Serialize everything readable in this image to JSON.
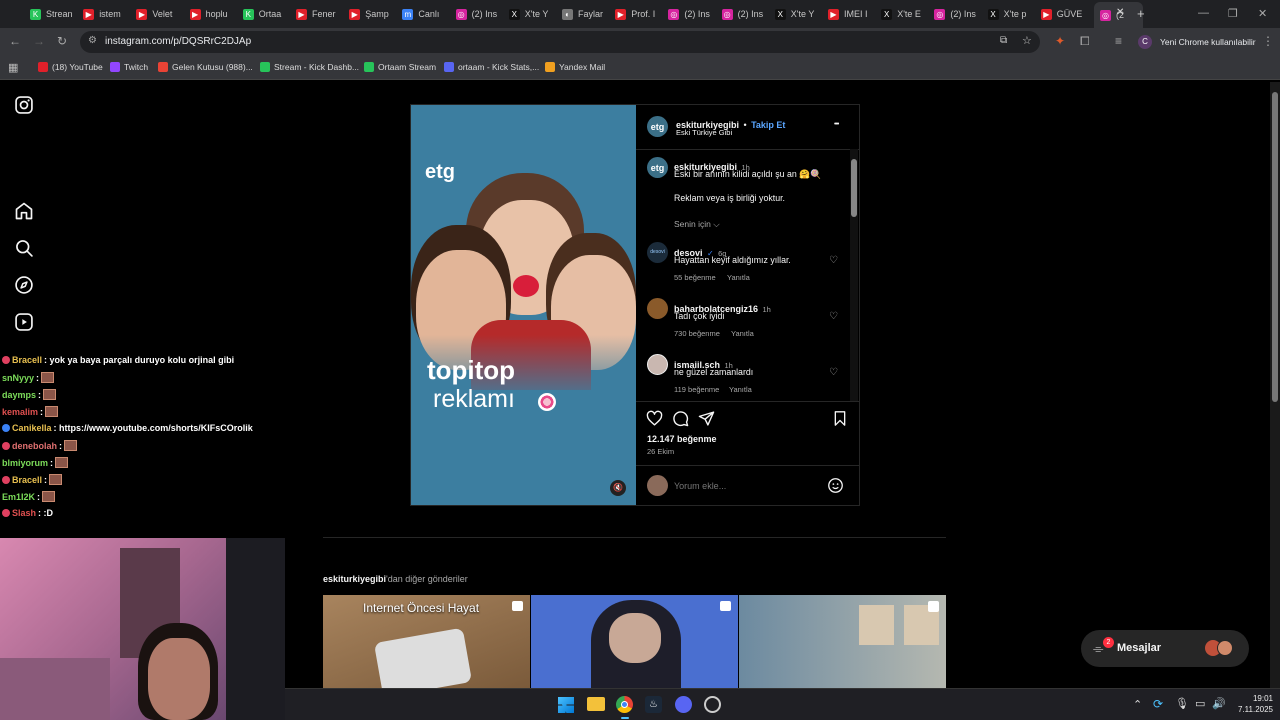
{
  "browser": {
    "tabs": [
      {
        "label": "Strean",
        "color": "#27c45a",
        "glyph": "K"
      },
      {
        "label": "istem",
        "color": "#e0202a",
        "glyph": "▶"
      },
      {
        "label": "Velet",
        "color": "#e0202a",
        "glyph": "▶"
      },
      {
        "label": "hoplu",
        "color": "#e0202a",
        "glyph": "▶"
      },
      {
        "label": "Ortaa",
        "color": "#27c45a",
        "glyph": "K"
      },
      {
        "label": "Fener",
        "color": "#e0202a",
        "glyph": "▶"
      },
      {
        "label": "Şamp",
        "color": "#e0202a",
        "glyph": "▶"
      },
      {
        "label": "Canlı",
        "color": "#3b82f6",
        "glyph": "m"
      },
      {
        "label": "(2) Ins",
        "color": "#d6249f",
        "glyph": "◎"
      },
      {
        "label": "X'te Y",
        "color": "#111111",
        "glyph": "X"
      },
      {
        "label": "Faylar",
        "color": "#777777",
        "glyph": "◐"
      },
      {
        "label": "Prof. I",
        "color": "#e0202a",
        "glyph": "▶"
      },
      {
        "label": "(2) Ins",
        "color": "#d6249f",
        "glyph": "◎"
      },
      {
        "label": "(2) Ins",
        "color": "#d6249f",
        "glyph": "◎"
      },
      {
        "label": "X'te Y",
        "color": "#111111",
        "glyph": "X"
      },
      {
        "label": "IMEI I",
        "color": "#e0202a",
        "glyph": "▶"
      },
      {
        "label": "X'te E",
        "color": "#111111",
        "glyph": "X"
      },
      {
        "label": "(2) Ins",
        "color": "#d6249f",
        "glyph": "◎"
      },
      {
        "label": "X'te p",
        "color": "#111111",
        "glyph": "X"
      },
      {
        "label": "GÜVE",
        "color": "#e0202a",
        "glyph": "▶"
      },
      {
        "label": "(2",
        "color": "#d6249f",
        "glyph": "◎"
      }
    ],
    "new_tab": "+",
    "url": "instagram.com/p/DQSRrC2DJAp",
    "update_label": "Yeni Chrome kullanılabilir",
    "profile_initial": "C",
    "bookmarks": [
      {
        "label": "(18) YouTube",
        "color": "#e0202a"
      },
      {
        "label": "Twitch",
        "color": "#9146ff"
      },
      {
        "label": "Gelen Kutusu (988)...",
        "color": "#ea4335"
      },
      {
        "label": "Stream - Kick Dashb...",
        "color": "#27c45a"
      },
      {
        "label": "Ortaam Stream",
        "color": "#27c45a"
      },
      {
        "label": "ortaam - Kick Stats,...",
        "color": "#5865f2"
      },
      {
        "label": "Yandex Mail",
        "color": "#f0a020"
      }
    ]
  },
  "post": {
    "media_logo": "etg",
    "media_title_1": "topitop",
    "media_title_2": "reklamı",
    "author": "eskiturkiyegibi",
    "dot": "•",
    "follow": "Takip Et",
    "author_subtitle": "Eski Türkiye Gibi",
    "more": "•••",
    "caption_author": "eskiturkiyegibi",
    "caption_time": "1h",
    "caption_text": "Eski bir anının kilidi açıldı şu an 🤗🍭",
    "caption_text2": "Reklam veya iş birliği yoktur.",
    "for_you": "Senin için ⌵",
    "comments": [
      {
        "user": "desovi",
        "verified": "✓",
        "time": "6g",
        "text": "Hayattan keyif aldığımız yıllar.",
        "likes": "55 beğenme",
        "reply": "Yanıtla",
        "color": "#1b2b3a"
      },
      {
        "user": "baharbolatcengiz16",
        "verified": "",
        "time": "1h",
        "text": "Tadı çok iyidi",
        "likes": "730 beğenme",
        "reply": "Yanıtla",
        "color": "#8a5a2a"
      },
      {
        "user": "ismaiil.sch",
        "verified": "",
        "time": "1h",
        "text": "ne güzel zamanlardı",
        "likes": "119 beğenme",
        "reply": "Yanıtla",
        "color": "#c9b7b0"
      }
    ],
    "like_count": "12.147 beğenme",
    "date": "26 Ekim",
    "comment_placeholder": "Yorum ekle..."
  },
  "more_posts": {
    "title_user": "eskiturkiyegibi",
    "title_rest": "'dan diğer gönderiler",
    "thumb1_text": "Internet Öncesi Hayat"
  },
  "messages": {
    "label": "Mesajlar",
    "badge": "2"
  },
  "chat": [
    {
      "user": "Bracell",
      "color": "#e8c050",
      "text": ": yok ya baya parçalı duruyo kolu orjinal gibi"
    },
    {
      "user": "snNyyy",
      "color": "#7cdc5a",
      "text": ":"
    },
    {
      "user": "daymps",
      "color": "#7cdc5a",
      "text": ":"
    },
    {
      "user": "kemalim",
      "color": "#e05050",
      "text": ":"
    },
    {
      "user": "Canikella",
      "color": "#e8c050",
      "text": ": https://www.youtube.com/shorts/KIFsCOrolik"
    },
    {
      "user": "denebolah",
      "color": "#e07070",
      "text": ":"
    },
    {
      "user": "blmiyorum",
      "color": "#7cdc5a",
      "text": ":"
    },
    {
      "user": "Bracell",
      "color": "#e8c050",
      "text": ":"
    },
    {
      "user": "Em1I2K",
      "color": "#7cdc5a",
      "text": ":"
    },
    {
      "user": "Slash",
      "color": "#e05050",
      "text": ": :D"
    }
  ],
  "taskbar": {
    "time": "19:01",
    "date": "7.11.2025"
  }
}
